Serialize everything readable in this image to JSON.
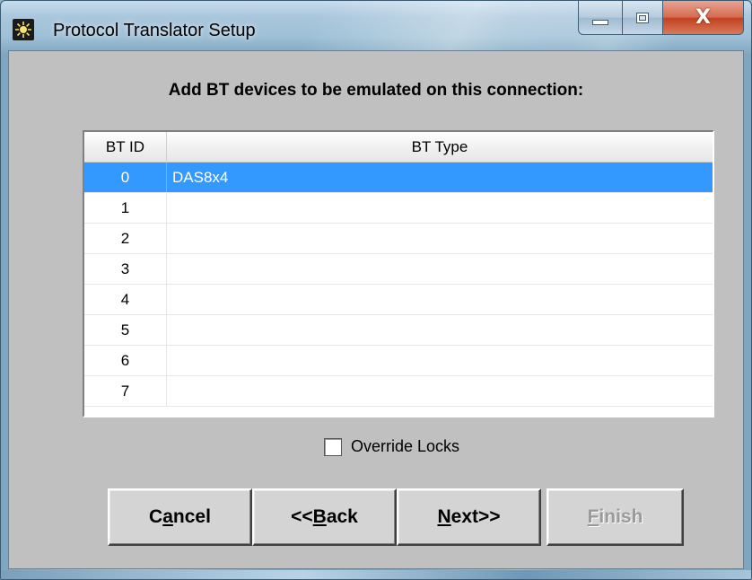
{
  "window": {
    "title": "Protocol Translator Setup",
    "icon": "sun-icon",
    "caption_buttons": [
      "minimize-icon",
      "maximize-icon",
      "close-icon"
    ],
    "close_glyph": "X"
  },
  "dialog": {
    "heading": "Add BT devices to be emulated on this connection:"
  },
  "grid": {
    "columns": [
      "BT ID",
      "BT Type"
    ],
    "rows": [
      {
        "id": "0",
        "type": "DAS8x4",
        "selected": true
      },
      {
        "id": "1",
        "type": ""
      },
      {
        "id": "2",
        "type": ""
      },
      {
        "id": "3",
        "type": ""
      },
      {
        "id": "4",
        "type": ""
      },
      {
        "id": "5",
        "type": ""
      },
      {
        "id": "6",
        "type": ""
      },
      {
        "id": "7",
        "type": ""
      }
    ],
    "selection_color": "#3399ff"
  },
  "override_locks": {
    "label": "Override Locks",
    "checked": false
  },
  "buttons": {
    "cancel": {
      "pre": "C",
      "mnemonic": "a",
      "post": "ncel"
    },
    "back": {
      "pre": "<<",
      "mnemonic": "B",
      "post": "ack"
    },
    "next": {
      "pre": "",
      "mnemonic": "N",
      "post": "ext>>"
    },
    "finish": {
      "pre": "",
      "mnemonic": "F",
      "post": "inish",
      "disabled": true
    }
  }
}
